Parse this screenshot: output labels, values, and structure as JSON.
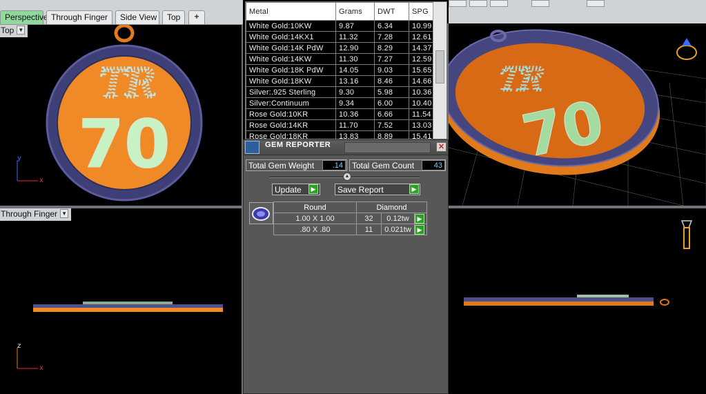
{
  "tabs": [
    {
      "label": "Perspective",
      "active": true
    },
    {
      "label": "Through Finger",
      "active": false
    },
    {
      "label": "Side View",
      "active": false
    },
    {
      "label": "Top",
      "active": false
    },
    {
      "label": "+",
      "active": false
    }
  ],
  "viewports": {
    "top_left": {
      "label": "Top",
      "axis1": "y",
      "axis2": "x"
    },
    "bottom_left": {
      "label": "Through Finger",
      "axis1": "z",
      "axis2": "x"
    }
  },
  "pendant": {
    "initials": "TR",
    "number": "70"
  },
  "metal_table": {
    "columns": [
      "Metal",
      "Grams",
      "DWT",
      "SPG"
    ],
    "rows": [
      [
        "White Gold:10KW",
        "9.87",
        "6.34",
        "10.99"
      ],
      [
        "White Gold:14KX1",
        "11.32",
        "7.28",
        "12.61"
      ],
      [
        "White Gold:14K PdW",
        "12.90",
        "8.29",
        "14.37"
      ],
      [
        "White Gold:14KW",
        "11.30",
        "7.27",
        "12.59"
      ],
      [
        "White Gold:18K PdW",
        "14.05",
        "9.03",
        "15.65"
      ],
      [
        "White Gold:18KW",
        "13.16",
        "8.46",
        "14.66"
      ],
      [
        "Silver:.925 Sterling",
        "9.30",
        "5.98",
        "10.36"
      ],
      [
        "Silver:Continuum",
        "9.34",
        "6.00",
        "10.40"
      ],
      [
        "Rose Gold:10KR",
        "10.36",
        "6.66",
        "11.54"
      ],
      [
        "Rose Gold:14KR",
        "11.70",
        "7.52",
        "13.03"
      ],
      [
        "Rose Gold:18KR",
        "13.83",
        "8.89",
        "15.41"
      ]
    ]
  },
  "gem_reporter": {
    "title": "GEM REPORTER",
    "close_glyph": "✕",
    "total_weight_label": "Total Gem Weight",
    "total_weight_value": ".14",
    "total_count_label": "Total Gem Count",
    "total_count_value": "43",
    "update_label": "Update",
    "save_label": "Save Report",
    "arrow_glyph": "▶",
    "shape_header": "Round",
    "type_header": "Diamond",
    "rows": [
      {
        "size": "1.00 X 1.00",
        "count": "32",
        "weight": "0.12tw"
      },
      {
        "size": ".80 X .80",
        "count": "11",
        "weight": "0.021tw"
      }
    ]
  },
  "colors": {
    "pendant_orange": "#f08a26",
    "frame_purple": "#4f4f8e",
    "letter_green": "#c9f2c4",
    "viewport_bg": "#000000"
  },
  "icons": [
    "ring-icon",
    "ring-side-icon",
    "gem-reporter-logo-icon",
    "round-gem-icon",
    "close-icon",
    "chevron-down-icon",
    "play-arrow-icon"
  ]
}
